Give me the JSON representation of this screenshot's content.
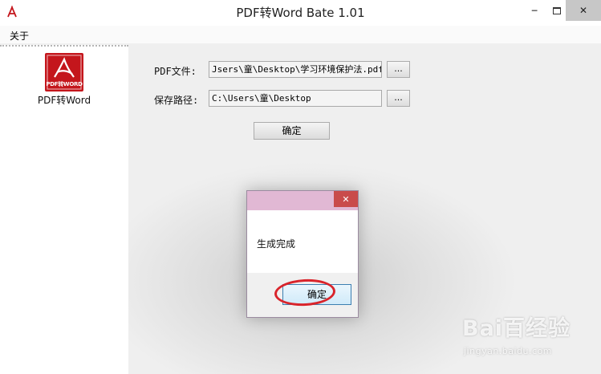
{
  "window": {
    "title": "PDF转Word Bate 1.01",
    "min_glyph": "─",
    "close_glyph": "✕"
  },
  "menu": {
    "about": "关于"
  },
  "sidebar": {
    "items": [
      {
        "label": "PDF转Word",
        "logo_text": "PDF转WORD",
        "icon": "pdf-logo-icon"
      }
    ]
  },
  "form": {
    "pdf_file": {
      "label": "PDF文件:",
      "value": "Jsers\\童\\Desktop\\学习环境保护法.pdf",
      "browse_label": "..."
    },
    "save_path": {
      "label": "保存路径:",
      "value": "C:\\Users\\童\\Desktop",
      "browse_label": "..."
    },
    "confirm_label": "确定"
  },
  "dialog": {
    "title": "",
    "message": "生成完成",
    "ok_label": "确定",
    "close_glyph": "✕"
  },
  "watermark": {
    "brand": "Bai百经验",
    "domain": "jingyan.baidu.com"
  },
  "colors": {
    "pdf_red": "#c4161c",
    "dialog_titlebar": "#e1b8d4",
    "dialog_close": "#c94b4b",
    "annotation_ring": "#d9242b"
  }
}
